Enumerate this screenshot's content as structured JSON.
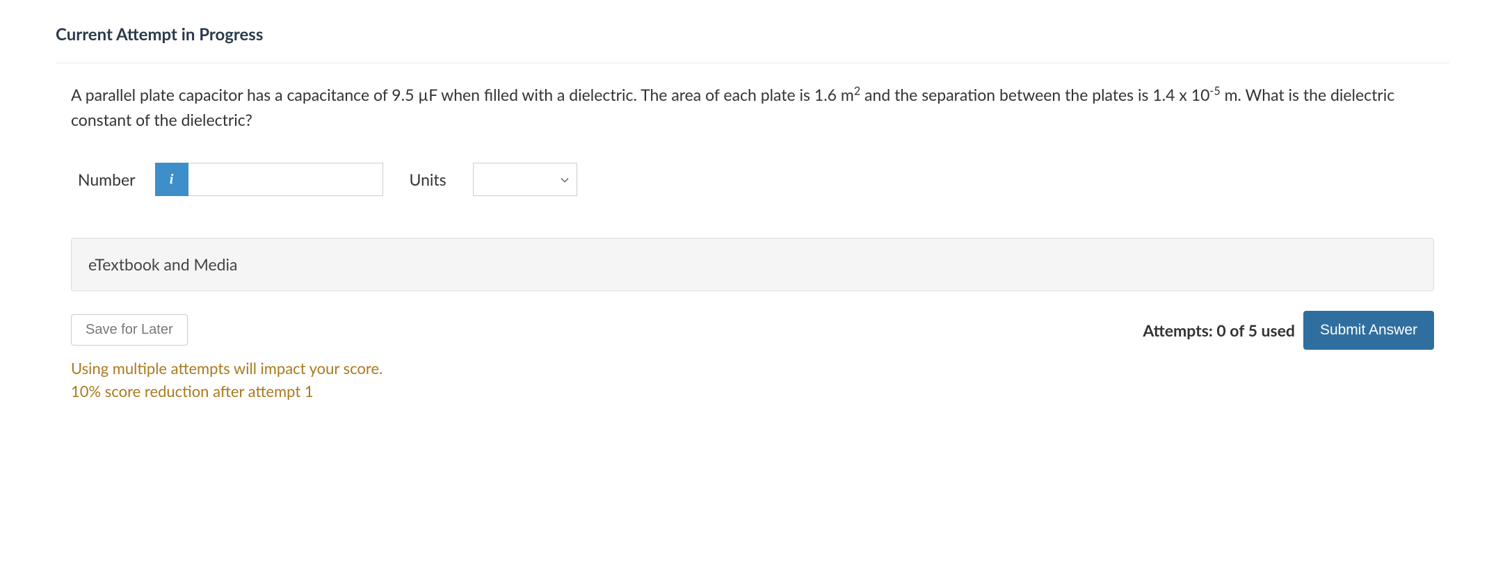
{
  "header": {
    "title": "Current Attempt in Progress"
  },
  "question": {
    "prefix": "A parallel plate capacitor has a capacitance of 9.5 µF when filled with a dielectric. The area of each plate is 1.6 m",
    "sup1": "2",
    "mid": " and the separation between the plates is 1.4 x 10",
    "sup2": "-5",
    "suffix": " m. What is the dielectric constant of the dielectric?"
  },
  "answer": {
    "number_label": "Number",
    "info_icon": "i",
    "number_value": "",
    "units_label": "Units",
    "units_value": ""
  },
  "resources": {
    "etextbook_label": "eTextbook and Media"
  },
  "footer": {
    "save_label": "Save for Later",
    "attempts_label": "Attempts: 0 of 5 used",
    "submit_label": "Submit Answer",
    "warning_line1": "Using multiple attempts will impact your score.",
    "warning_line2": "10% score reduction after attempt 1"
  }
}
